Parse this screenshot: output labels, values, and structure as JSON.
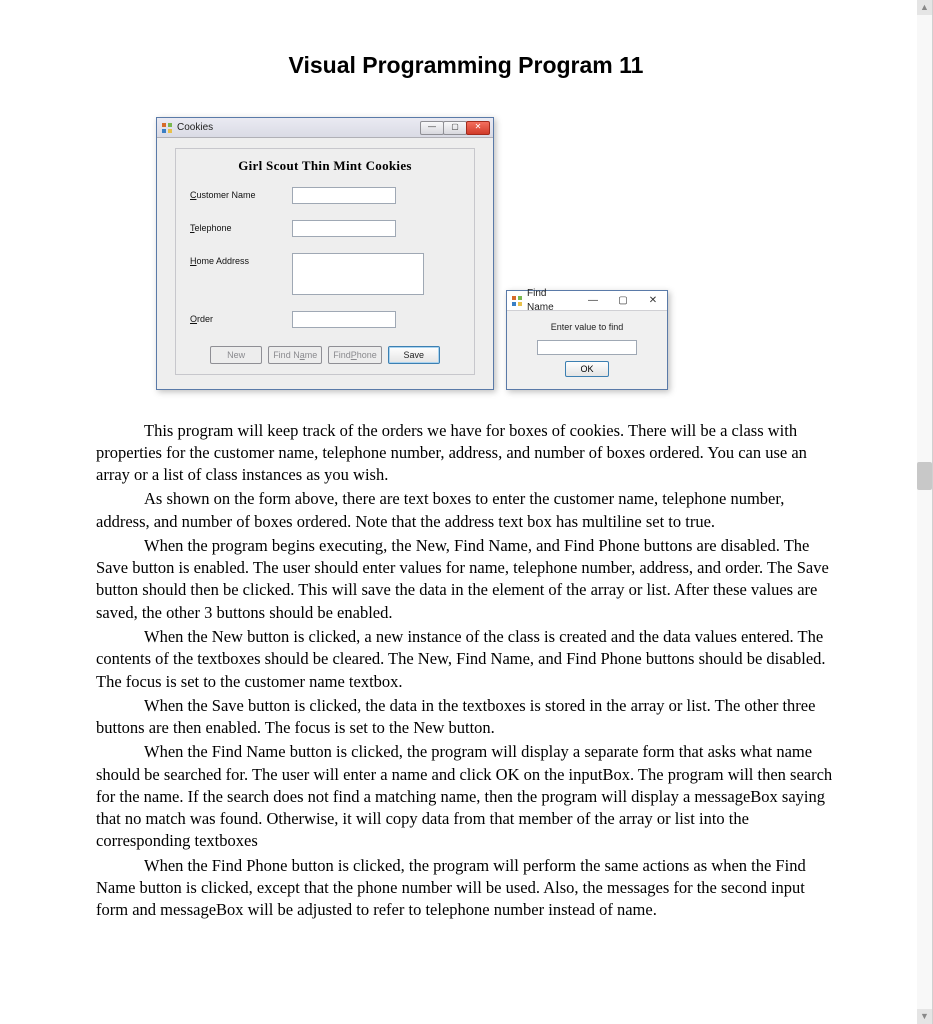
{
  "title": "Visual Programming Program 11",
  "main_form": {
    "window_title": "Cookies",
    "group_title": "Girl Scout Thin Mint Cookies",
    "fields": {
      "customer_name": {
        "label": "Customer Name",
        "value": ""
      },
      "telephone": {
        "label": "Telephone",
        "value": ""
      },
      "home_address": {
        "label": "Home Address",
        "value": ""
      },
      "order": {
        "label": "Order",
        "value": ""
      }
    },
    "buttons": {
      "new": "New",
      "find_name": "Find Name",
      "find_phone": "Find Phone",
      "save": "Save"
    }
  },
  "find_form": {
    "window_title": "Find Name",
    "prompt": "Enter value to find",
    "value": "",
    "ok": "OK"
  },
  "paragraphs": [
    "This program will keep track of the orders we have for boxes of cookies.  There will be a class with properties for the customer name, telephone number, address, and number of boxes ordered.  You can use an array or a list of class instances as you wish.",
    "As shown on the form above, there are text boxes to enter the customer name, telephone number, address, and number of boxes ordered.  Note that the address text box has multiline set to true.",
    "When the program begins executing, the New, Find Name, and Find Phone buttons are disabled.  The Save button is enabled.  The user should enter values for name, telephone number, address, and order.  The Save button should then be clicked.  This will save the data in the element of the array or list.  After these values are saved, the other 3 buttons should be enabled.",
    "When the New button is clicked, a new instance of the class is created and the data values entered.  The contents of the textboxes should be cleared.  The New, Find Name, and Find Phone buttons should be disabled.  The focus is set to the customer name textbox.",
    "When the Save button is clicked, the data in the textboxes is stored in the array or list.  The other three buttons are then enabled.  The focus is set to the New button.",
    "When the Find Name button is clicked, the program will display a separate form that asks what name should be searched for.  The user will enter a name and click OK on the inputBox.  The program will then search for the name.  If the search does not find a matching name, then the program will display a messageBox saying that no match was found.  Otherwise, it will copy data from that member of the array or list into the corresponding textboxes",
    "When the Find Phone button is clicked, the program will perform the same actions as when the Find Name button is clicked, except that the phone number will be used.  Also, the messages for the second input form and messageBox will be adjusted to refer to telephone number instead of name."
  ]
}
